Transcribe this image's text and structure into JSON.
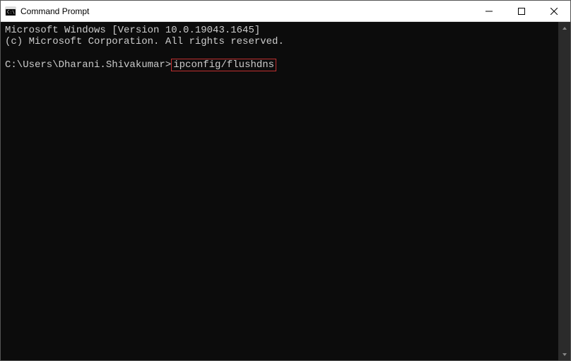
{
  "window": {
    "title": "Command Prompt"
  },
  "terminal": {
    "line1": "Microsoft Windows [Version 10.0.19043.1645]",
    "line2": "(c) Microsoft Corporation. All rights reserved.",
    "prompt": "C:\\Users\\Dharani.Shivakumar>",
    "command": "ipconfig/flushdns"
  },
  "highlight": {
    "color": "#c03030"
  }
}
